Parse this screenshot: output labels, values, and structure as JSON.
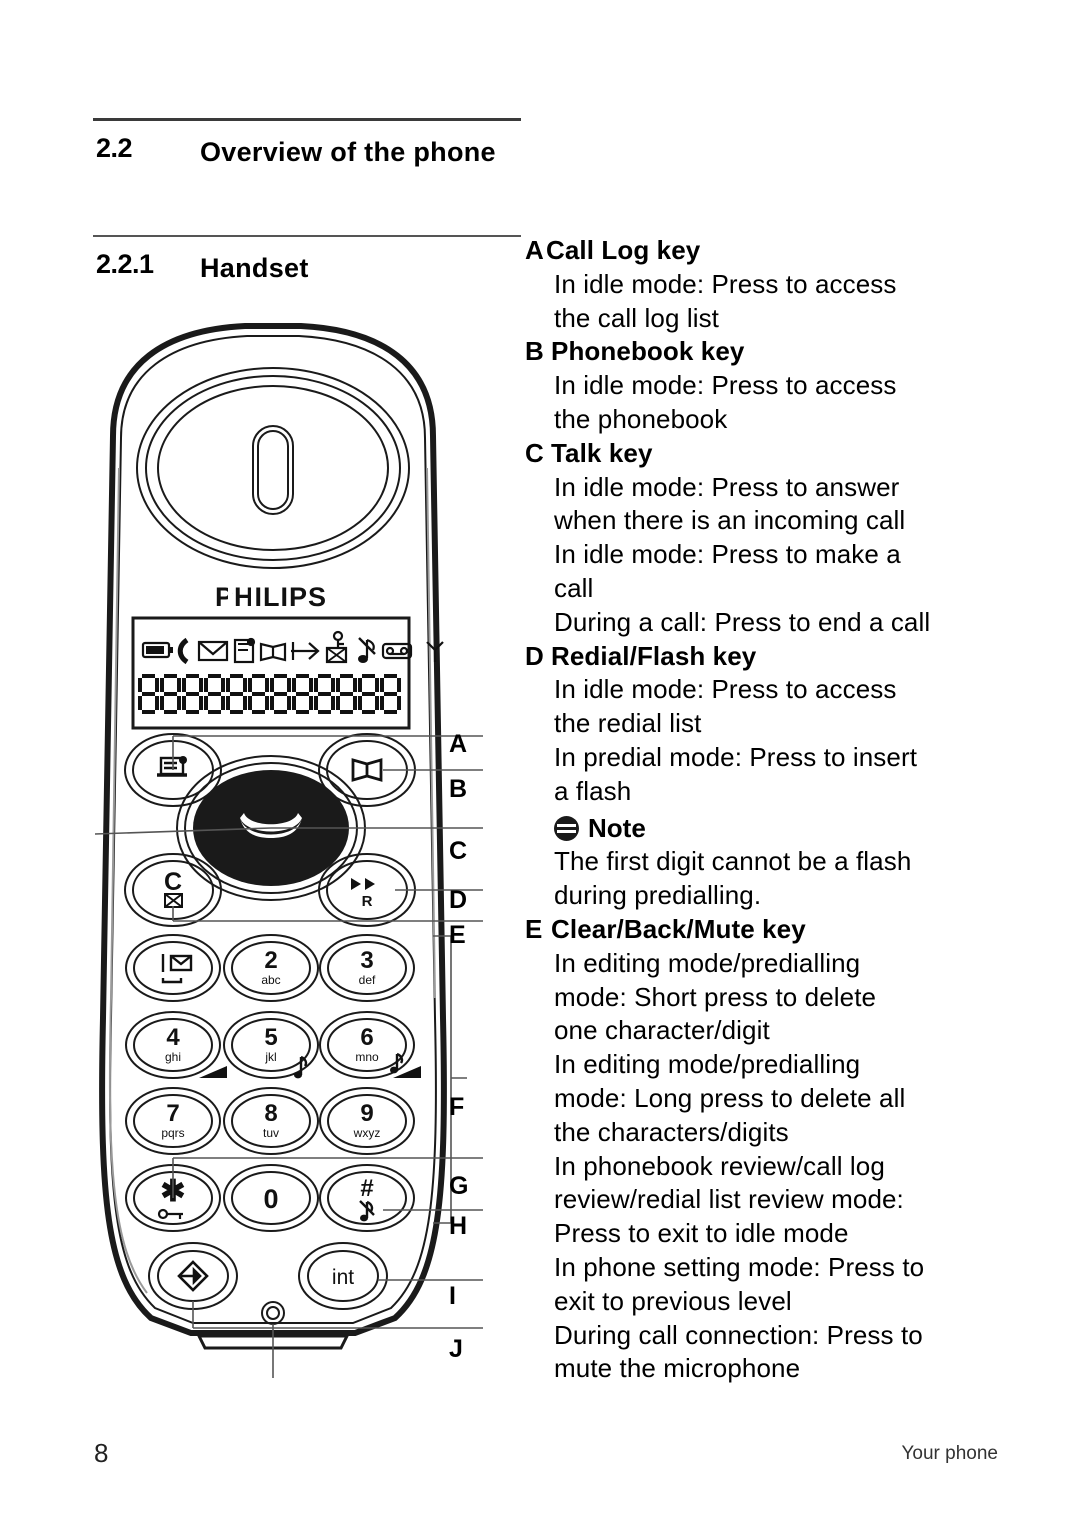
{
  "page": {
    "number": "8",
    "footer_title": "Your phone"
  },
  "sections": {
    "overview": {
      "number": "2.2",
      "title": "Overview of the phone"
    },
    "handset": {
      "number": "2.2.1",
      "title": "Handset"
    }
  },
  "key_descriptions": [
    {
      "letter": "A",
      "title": "Call Log key",
      "tight": true,
      "lines": [
        "In idle mode: Press to access",
        "the call log list"
      ]
    },
    {
      "letter": "B",
      "title": "Phonebook key",
      "tight": false,
      "lines": [
        "In idle mode: Press to access",
        "the phonebook"
      ]
    },
    {
      "letter": "C",
      "title": "Talk key",
      "tight": false,
      "lines": [
        "In idle mode: Press to answer",
        "when there is an incoming call",
        "In idle mode: Press to make a",
        "call",
        "During a call: Press to end a call"
      ]
    },
    {
      "letter": "D",
      "title": "Redial/Flash key",
      "tight": false,
      "lines": [
        "In idle mode: Press to access",
        "the redial list",
        "In predial mode: Press to insert",
        "a flash"
      ],
      "note": {
        "icon": "note-icon",
        "label": "Note",
        "lines": [
          "The first digit cannot be a flash",
          "during predialling."
        ]
      }
    },
    {
      "letter": "E",
      "title": "Clear/Back/Mute key",
      "tight": false,
      "lines": [
        "In editing mode/predialling",
        "mode: Short press to delete",
        "one character/digit",
        "In editing mode/predialling",
        "mode: Long press to delete all",
        "the characters/digits",
        "In phonebook review/call log",
        "review/redial list review mode:",
        "Press to exit to idle mode",
        "In phone setting mode: Press to",
        "exit to previous level",
        "During call connection: Press to",
        "mute the microphone"
      ]
    }
  ],
  "handset_figure": {
    "brand": "PHILIPS",
    "lcd": {
      "status_icons": [
        "battery-icon",
        "handset-icon",
        "envelope-icon",
        "voicemail-icon",
        "phonebook-icon",
        "call-forward-icon",
        "alarm-off-icon",
        "ringer-off-icon",
        "answering-machine-icon",
        "antenna-icon"
      ],
      "segment_digits": "888888888888"
    },
    "keys": [
      {
        "id": "call-log",
        "icon": "call-log-icon",
        "label": "",
        "callout": "A"
      },
      {
        "id": "phonebook",
        "icon": "book-icon",
        "label": "",
        "callout": "B"
      },
      {
        "id": "talk",
        "icon": "talk-icon",
        "label": "",
        "callout": "C"
      },
      {
        "id": "redial",
        "icon": "redial-r-icon",
        "label": "R",
        "callout": "D"
      },
      {
        "id": "clear",
        "icon": "clear-mute-icon",
        "label": "C",
        "callout": "E"
      },
      {
        "id": "key-1",
        "icon": "envelope-space-icon",
        "label": "1",
        "sub": ""
      },
      {
        "id": "key-2",
        "icon": "",
        "label": "2",
        "sub": "abc"
      },
      {
        "id": "key-3",
        "icon": "",
        "label": "3",
        "sub": "def"
      },
      {
        "id": "key-4",
        "icon": "",
        "label": "4",
        "sub": "ghi"
      },
      {
        "id": "key-5",
        "icon": "",
        "label": "5",
        "sub": "jkl"
      },
      {
        "id": "key-6",
        "icon": "",
        "label": "6",
        "sub": "mno"
      },
      {
        "id": "key-7",
        "icon": "",
        "label": "7",
        "sub": "pqrs"
      },
      {
        "id": "key-8",
        "icon": "",
        "label": "8",
        "sub": "tuv"
      },
      {
        "id": "key-9",
        "icon": "",
        "label": "9",
        "sub": "wxyz"
      },
      {
        "id": "key-star",
        "icon": "keylock-icon",
        "label": "*",
        "sub": "",
        "callout": "G"
      },
      {
        "id": "key-0",
        "icon": "",
        "label": "0",
        "sub": ""
      },
      {
        "id": "key-hash",
        "icon": "ringer-off-icon",
        "label": "#",
        "sub": "",
        "callout": "H"
      },
      {
        "id": "menu",
        "icon": "menu-diamond-icon",
        "label": "",
        "callout": "J"
      },
      {
        "id": "intercom",
        "icon": "",
        "label": "int",
        "callout": "I"
      }
    ],
    "callout_labels": [
      "A",
      "B",
      "C",
      "D",
      "E",
      "F",
      "G",
      "H",
      "I",
      "J"
    ]
  }
}
